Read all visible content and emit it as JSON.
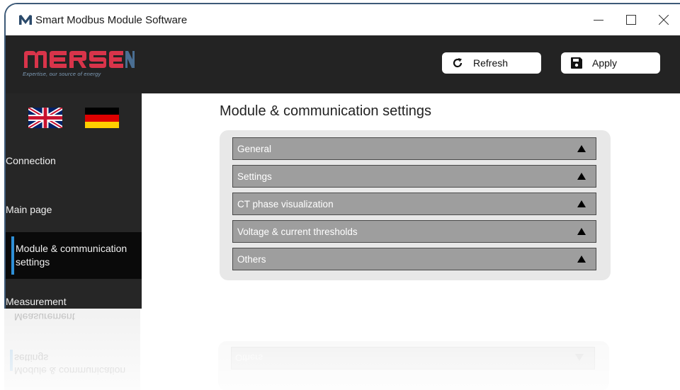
{
  "window": {
    "title": "Smart Modbus Module Software",
    "app_icon": "mersen-m-icon"
  },
  "window_controls": {
    "minimize_icon": "minimize-icon",
    "maximize_icon": "maximize-icon",
    "close_icon": "close-icon"
  },
  "header": {
    "logo_text": "MERSEN",
    "logo_tagline": "Expertise, our source of energy",
    "refresh_label": "Refresh",
    "refresh_icon": "refresh-icon",
    "apply_label": "Apply",
    "apply_icon": "save-icon"
  },
  "sidebar": {
    "languages": [
      {
        "name": "English",
        "icon": "uk-flag-icon"
      },
      {
        "name": "German",
        "icon": "germany-flag-icon"
      }
    ],
    "items": [
      {
        "label": "Connection",
        "active": false
      },
      {
        "label": "Main page",
        "active": false
      },
      {
        "label": "Module & communication settings",
        "line1": "Module & communication",
        "line2": "settings",
        "active": true
      },
      {
        "label": "Measurement",
        "active": false
      }
    ]
  },
  "main": {
    "title": "Module & communication settings",
    "sections": [
      {
        "label": "General",
        "state": "collapsed"
      },
      {
        "label": "Settings",
        "state": "collapsed"
      },
      {
        "label": "CT phase visualization",
        "state": "collapsed"
      },
      {
        "label": "Voltage & current thresholds",
        "state": "collapsed"
      },
      {
        "label": "Others",
        "state": "collapsed"
      }
    ]
  },
  "colors": {
    "header_bg": "#232323",
    "sidebar_bg": "#262626",
    "active_item_bg": "#0a0a0a",
    "active_indicator": "#2e8fd6",
    "section_bg": "#9e9e9e",
    "panel_bg": "#e8e8e8",
    "logo_red": "#d8344a",
    "logo_blue": "#4a6e92"
  }
}
